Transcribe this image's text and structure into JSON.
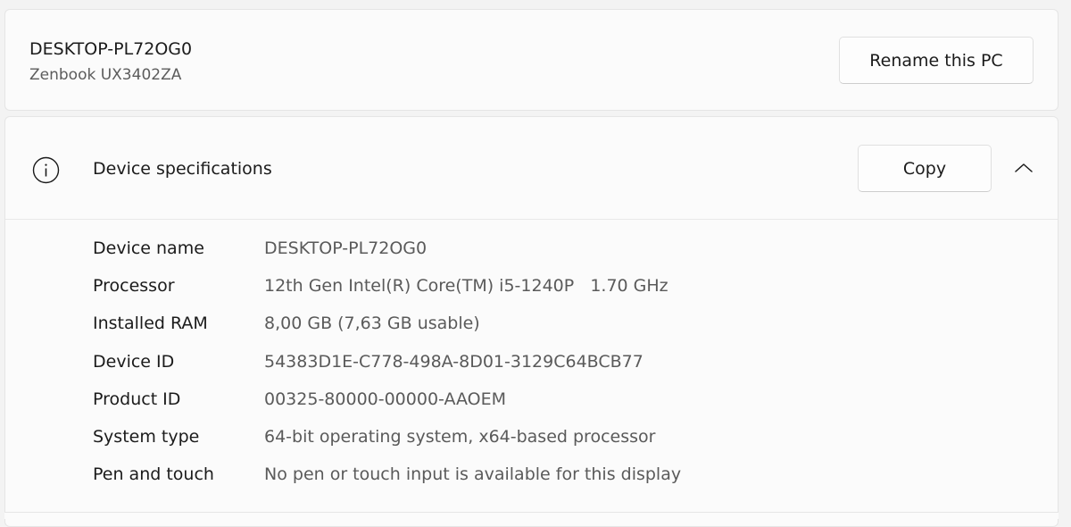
{
  "device": {
    "name": "DESKTOP-PL72OG0",
    "model": "Zenbook UX3402ZA",
    "rename_label": "Rename this PC"
  },
  "specs": {
    "title": "Device specifications",
    "copy_label": "Copy",
    "icon": "info-icon",
    "toggle_icon": "chevron-up-icon",
    "expanded": true,
    "rows": [
      {
        "label": "Device name",
        "value": "DESKTOP-PL72OG0"
      },
      {
        "label": "Processor",
        "value": "12th Gen Intel(R) Core(TM) i5-1240P   1.70 GHz"
      },
      {
        "label": "Installed RAM",
        "value": "8,00 GB (7,63 GB usable)"
      },
      {
        "label": "Device ID",
        "value": "54383D1E-C778-498A-8D01-3129C64BCB77"
      },
      {
        "label": "Product ID",
        "value": "00325-80000-00000-AAOEM"
      },
      {
        "label": "System type",
        "value": "64-bit operating system, x64-based processor"
      },
      {
        "label": "Pen and touch",
        "value": "No pen or touch input is available for this display"
      }
    ]
  },
  "colors": {
    "background": "#f3f3f3",
    "card": "#fbfbfb",
    "border": "#e5e5e5",
    "secondary_text": "#5c5c5c"
  }
}
